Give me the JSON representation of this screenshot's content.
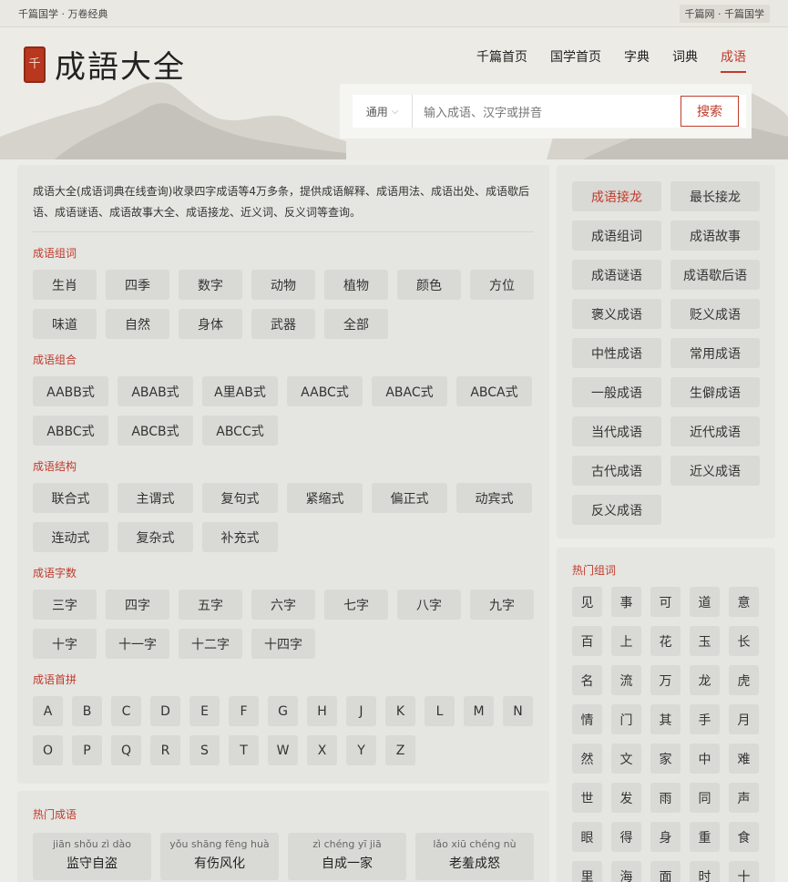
{
  "topbar": {
    "left": "千篇国学 · 万卷经典",
    "right": "千篇网 · 千篇国学"
  },
  "logo": {
    "seal": "千",
    "title": "成語大全"
  },
  "nav": [
    "千篇首页",
    "国学首页",
    "字典",
    "词典",
    "成语"
  ],
  "search": {
    "select": "通用",
    "placeholder": "输入成语、汉字或拼音",
    "button": "搜索"
  },
  "intro": "成语大全(成语词典在线查询)收录四字成语等4万多条，提供成语解释、成语用法、成语出处、成语歇后语、成语谜语、成语故事大全、成语接龙、近义词、反义词等查询。",
  "sections": [
    {
      "title": "成语组词",
      "items": [
        "生肖",
        "四季",
        "数字",
        "动物",
        "植物",
        "颜色",
        "方位",
        "味道",
        "自然",
        "身体",
        "武器",
        "全部"
      ]
    },
    {
      "title": "成语组合",
      "items": [
        "AABB式",
        "ABAB式",
        "A里AB式",
        "AABC式",
        "ABAC式",
        "ABCA式",
        "ABBC式",
        "ABCB式",
        "ABCC式"
      ]
    },
    {
      "title": "成语结构",
      "items": [
        "联合式",
        "主谓式",
        "复句式",
        "紧缩式",
        "偏正式",
        "动宾式",
        "连动式",
        "复杂式",
        "补充式"
      ]
    },
    {
      "title": "成语字数",
      "items": [
        "三字",
        "四字",
        "五字",
        "六字",
        "七字",
        "八字",
        "九字",
        "十字",
        "十一字",
        "十二字",
        "十四字"
      ]
    },
    {
      "title": "成语首拼",
      "items": [
        "A",
        "B",
        "C",
        "D",
        "E",
        "F",
        "G",
        "H",
        "J",
        "K",
        "L",
        "M",
        "N",
        "O",
        "P",
        "Q",
        "R",
        "S",
        "T",
        "W",
        "X",
        "Y",
        "Z"
      ]
    }
  ],
  "hot_idioms": {
    "title": "热门成语",
    "items": [
      {
        "py": "jiān shǒu zì dào",
        "hz": "监守自盗"
      },
      {
        "py": "yǒu shāng fēng huà",
        "hz": "有伤风化"
      },
      {
        "py": "zì chéng yī jiā",
        "hz": "自成一家"
      },
      {
        "py": "lǎo xiū chéng nù",
        "hz": "老羞成怒"
      }
    ]
  },
  "side_links": [
    "成语接龙",
    "最长接龙",
    "成语组词",
    "成语故事",
    "成语谜语",
    "成语歇后语",
    "褒义成语",
    "贬义成语",
    "中性成语",
    "常用成语",
    "一般成语",
    "生僻成语",
    "当代成语",
    "近代成语",
    "古代成语",
    "近义成语",
    "反义成语"
  ],
  "hot_chars": {
    "title": "热门组词",
    "items": [
      "见",
      "事",
      "可",
      "道",
      "意",
      "百",
      "上",
      "花",
      "玉",
      "长",
      "名",
      "流",
      "万",
      "龙",
      "虎",
      "情",
      "门",
      "其",
      "手",
      "月",
      "然",
      "文",
      "家",
      "中",
      "难",
      "世",
      "发",
      "雨",
      "同",
      "声",
      "眼",
      "得",
      "身",
      "重",
      "食",
      "里",
      "海",
      "面",
      "时",
      "十"
    ]
  },
  "colors": {
    "accent": "#c0392b",
    "panel": "#e5e5e1",
    "chip": "#d9d9d5"
  }
}
